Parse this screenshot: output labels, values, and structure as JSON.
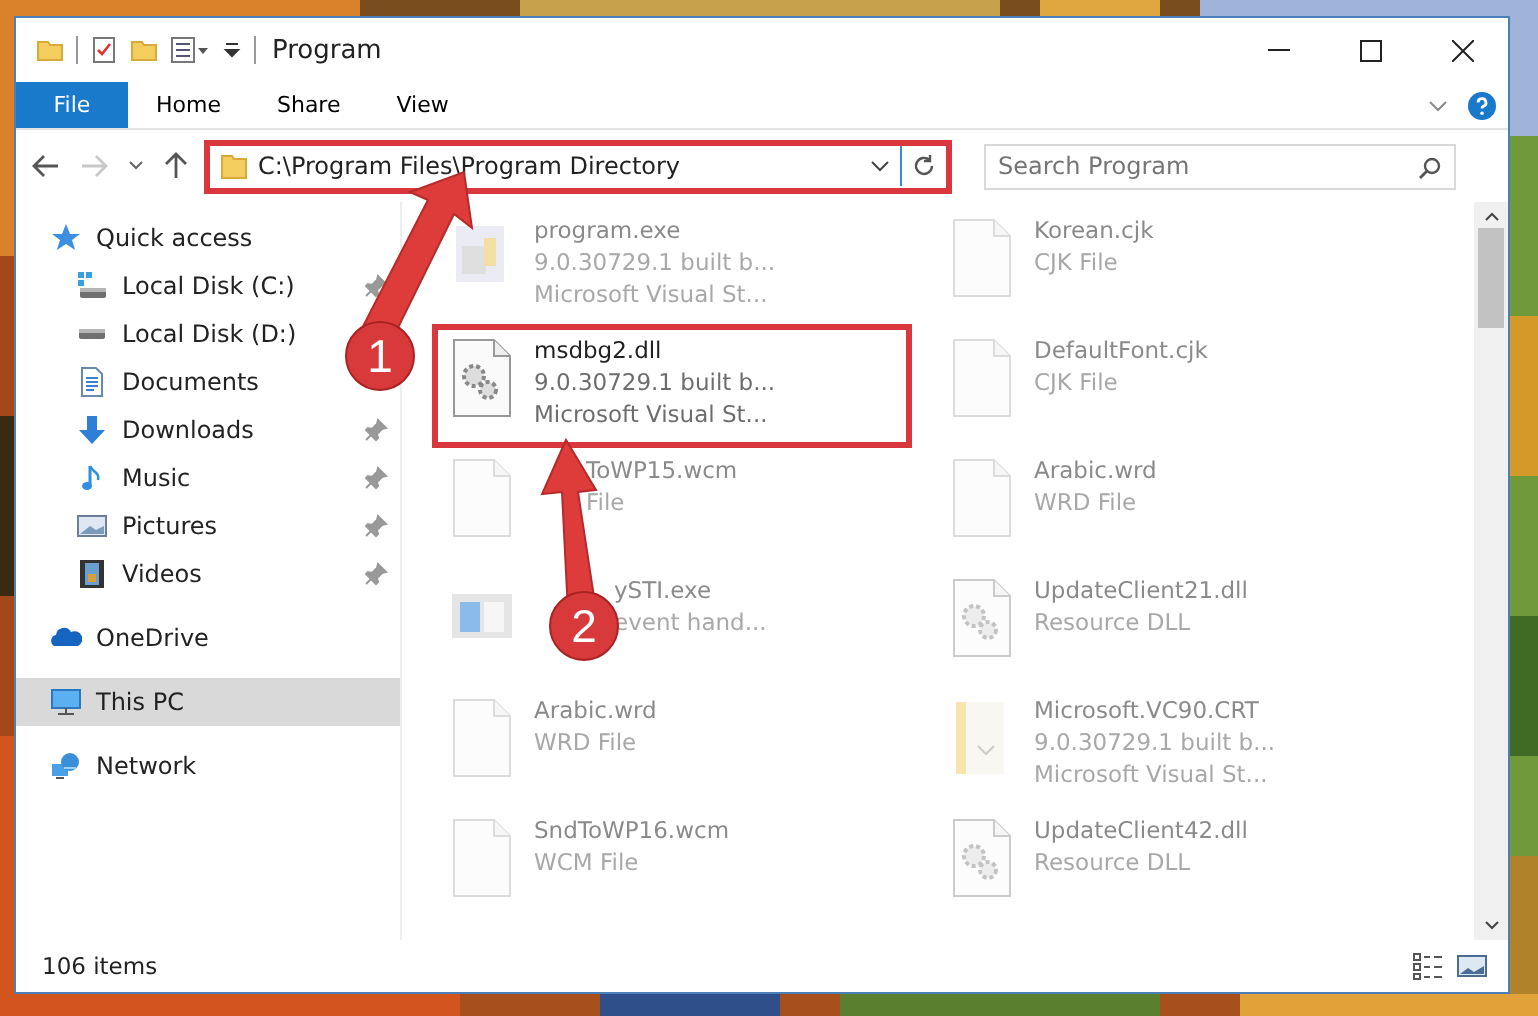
{
  "window": {
    "title": "Program"
  },
  "ribbon": {
    "tabs": [
      {
        "label": "File",
        "kind": "file"
      },
      {
        "label": "Home",
        "kind": "tab"
      },
      {
        "label": "Share",
        "kind": "tab"
      },
      {
        "label": "View",
        "kind": "tab"
      }
    ]
  },
  "nav": {
    "back": {
      "disabled": false
    },
    "forward": {
      "disabled": true
    }
  },
  "address": {
    "path": "C:\\Program Files\\Program Directory",
    "annotated": true
  },
  "search": {
    "placeholder": "Search Program"
  },
  "sidebar": {
    "items": [
      {
        "label": "Quick access",
        "kind": "star",
        "selected": false,
        "children": [
          {
            "label": "Local Disk (C:)",
            "kind": "drive-c",
            "pinned": true
          },
          {
            "label": "Local Disk (D:)",
            "kind": "drive"
          },
          {
            "label": "Documents",
            "kind": "documents"
          },
          {
            "label": "Downloads",
            "kind": "downloads",
            "pinned": true
          },
          {
            "label": "Music",
            "kind": "music",
            "pinned": true
          },
          {
            "label": "Pictures",
            "kind": "pictures",
            "pinned": true
          },
          {
            "label": "Videos",
            "kind": "videos",
            "pinned": true
          }
        ]
      },
      {
        "label": "OneDrive",
        "kind": "cloud",
        "selected": false
      },
      {
        "label": "This PC",
        "kind": "pc",
        "selected": true
      },
      {
        "label": "Network",
        "kind": "network",
        "selected": false
      }
    ]
  },
  "files": [
    {
      "name": "program.exe",
      "details": [
        "9.0.30729.1 built b...",
        "Microsoft Visual St..."
      ],
      "kind": "exe",
      "faded": true,
      "annotated": false
    },
    {
      "name": "Korean.cjk",
      "details": [
        "CJK File"
      ],
      "kind": "blank",
      "faded": true,
      "annotated": false
    },
    {
      "name": "msdbg2.dll",
      "details": [
        "9.0.30729.1 built b...",
        "Microsoft Visual St..."
      ],
      "kind": "gear",
      "faded": false,
      "annotated": true
    },
    {
      "name": "DefaultFont.cjk",
      "details": [
        "CJK File"
      ],
      "kind": "blank",
      "faded": true,
      "annotated": false
    },
    {
      "name": "ToWP15.wcm",
      "details": [
        "File"
      ],
      "kind": "blank",
      "faded": true,
      "annotated": false
    },
    {
      "name": "Arabic.wrd",
      "details": [
        "WRD File"
      ],
      "kind": "blank",
      "faded": true,
      "annotated": false
    },
    {
      "name": "ySTI.exe",
      "details": [
        "event hand..."
      ],
      "kind": "app",
      "faded": true,
      "annotated": false
    },
    {
      "name": "UpdateClient21.dll",
      "details": [
        "Resource DLL"
      ],
      "kind": "resource",
      "faded": true,
      "annotated": false
    },
    {
      "name": "Arabic.wrd",
      "details": [
        "WRD File"
      ],
      "kind": "blank",
      "faded": true,
      "annotated": false
    },
    {
      "name": "Microsoft.VC90.CRT",
      "details": [
        "9.0.30729.1 built b...",
        "Microsoft Visual St..."
      ],
      "kind": "manifest",
      "faded": true,
      "annotated": false
    },
    {
      "name": "SndToWP16.wcm",
      "details": [
        "WCM File"
      ],
      "kind": "blank",
      "faded": true,
      "annotated": false
    },
    {
      "name": "UpdateClient42.dll",
      "details": [
        "Resource DLL"
      ],
      "kind": "resource",
      "faded": true,
      "annotated": false
    }
  ],
  "status": {
    "count": "106 items"
  },
  "callouts": [
    {
      "number": "1"
    },
    {
      "number": "2"
    }
  ]
}
